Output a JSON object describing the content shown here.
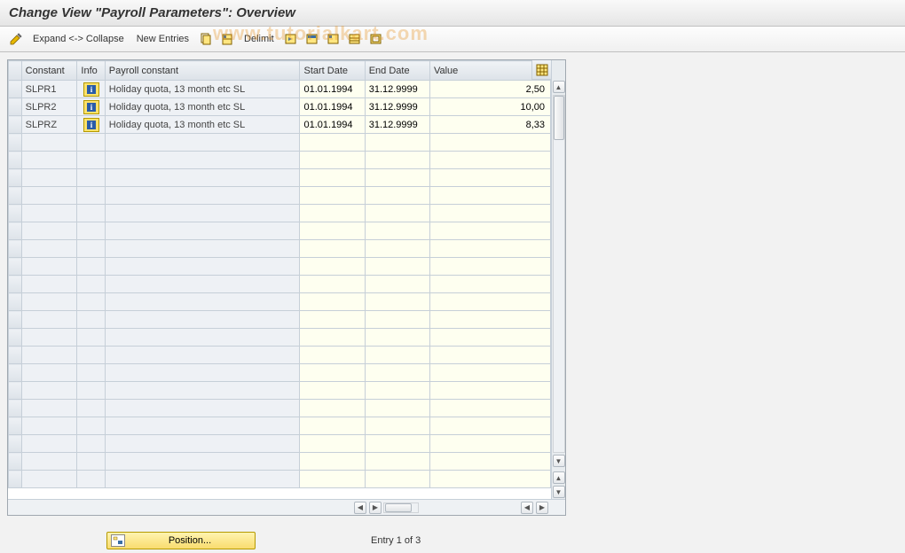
{
  "title": "Change View \"Payroll Parameters\": Overview",
  "watermark": "www.tutorialkart.com",
  "toolbar": {
    "expand_collapse": "Expand <-> Collapse",
    "new_entries": "New Entries",
    "delimit": "Delimit"
  },
  "table": {
    "headers": {
      "constant": "Constant",
      "info": "Info",
      "payroll_constant": "Payroll constant",
      "start_date": "Start Date",
      "end_date": "End Date",
      "value": "Value"
    },
    "rows": [
      {
        "constant": "SLPR1",
        "payroll_constant": "Holiday quota, 13 month etc SL",
        "start_date": "01.01.1994",
        "end_date": "31.12.9999",
        "value": "2,50"
      },
      {
        "constant": "SLPR2",
        "payroll_constant": "Holiday quota, 13 month etc SL",
        "start_date": "01.01.1994",
        "end_date": "31.12.9999",
        "value": "10,00"
      },
      {
        "constant": "SLPRZ",
        "payroll_constant": "Holiday quota, 13 month etc SL",
        "start_date": "01.01.1994",
        "end_date": "31.12.9999",
        "value": "8,33"
      }
    ],
    "empty_rows": 20
  },
  "footer": {
    "position_label": "Position...",
    "entry_status": "Entry 1 of 3"
  }
}
